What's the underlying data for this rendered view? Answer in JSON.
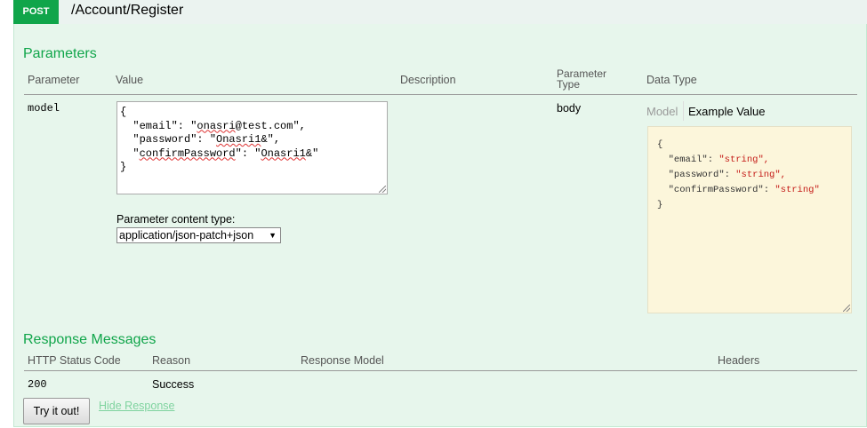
{
  "operation": {
    "method": "POST",
    "path": "/Account/Register"
  },
  "parameters": {
    "title": "Parameters",
    "columns": {
      "parameter": "Parameter",
      "value": "Value",
      "description": "Description",
      "parameter_type_line1": "Parameter",
      "parameter_type_line2": "Type",
      "data_type": "Data Type"
    },
    "rows": [
      {
        "name": "model",
        "value_lines": [
          "{",
          "  \"email\": \"onasri@test.com\",",
          "  \"password\": \"Onasri1&\",",
          "  \"confirmPassword\": \"Onasri1&\"",
          "}"
        ],
        "parameter_type": "body",
        "content_type_label": "Parameter content type:",
        "content_type_selected": "application/json-patch+json",
        "data_type_tabs": {
          "model": "Model",
          "example": "Example Value"
        },
        "example_value": {
          "open": "{",
          "email_key": "\"email\":",
          "email_val": "\"string\",",
          "password_key": "\"password\":",
          "password_val": "\"string\",",
          "confirm_key": "\"confirmPassword\":",
          "confirm_val": "\"string\"",
          "close": "}"
        }
      }
    ]
  },
  "responses": {
    "title": "Response Messages",
    "columns": {
      "status": "HTTP Status Code",
      "reason": "Reason",
      "model": "Response Model",
      "headers": "Headers"
    },
    "rows": [
      {
        "status": "200",
        "reason": "Success"
      }
    ]
  },
  "actions": {
    "try_it_out": "Try it out!",
    "hide_response": "Hide Response"
  },
  "colors": {
    "method_post": "#10a54a",
    "section_title": "#10a54a",
    "panel_bg": "#e7f6ec",
    "example_bg": "#fcf6db",
    "string_literal": "#c41a16",
    "link": "#7fd39f"
  }
}
